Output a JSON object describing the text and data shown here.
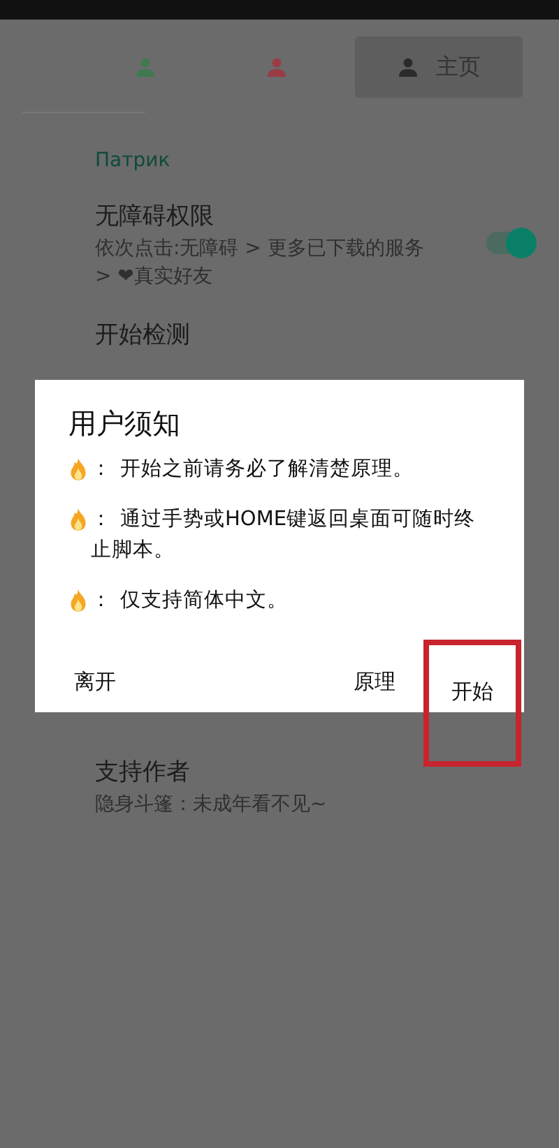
{
  "tabs": [
    {
      "color": "#3f7a4e",
      "selected": false
    },
    {
      "color": "#9a3b45",
      "selected": false
    },
    {
      "label": "主页",
      "color": "#2a2a2a",
      "selected": true
    }
  ],
  "section": {
    "title": "Патрик"
  },
  "items": [
    {
      "kind": "toggle",
      "title": "无障碍权限",
      "subtitle": "依次点击:无障碍 > 更多已下载的服务 > ❤真实好友",
      "on": true
    },
    {
      "kind": "plain",
      "title": "开始检测"
    },
    {
      "kind": "plain",
      "title": "支持作者",
      "subtitle": "隐身斗篷：未成年看不见~"
    }
  ],
  "dialog": {
    "title": "用户须知",
    "lines": [
      "开始之前请务必了解清楚原理。",
      "通过手势或HOME键返回桌面可随时终止脚本。",
      "仅支持简体中文。"
    ],
    "separator": "：",
    "buttons": [
      {
        "label": "离开",
        "highlighted": false
      },
      {
        "label": "原理",
        "highlighted": false
      },
      {
        "label": "开始",
        "highlighted": true
      }
    ]
  }
}
